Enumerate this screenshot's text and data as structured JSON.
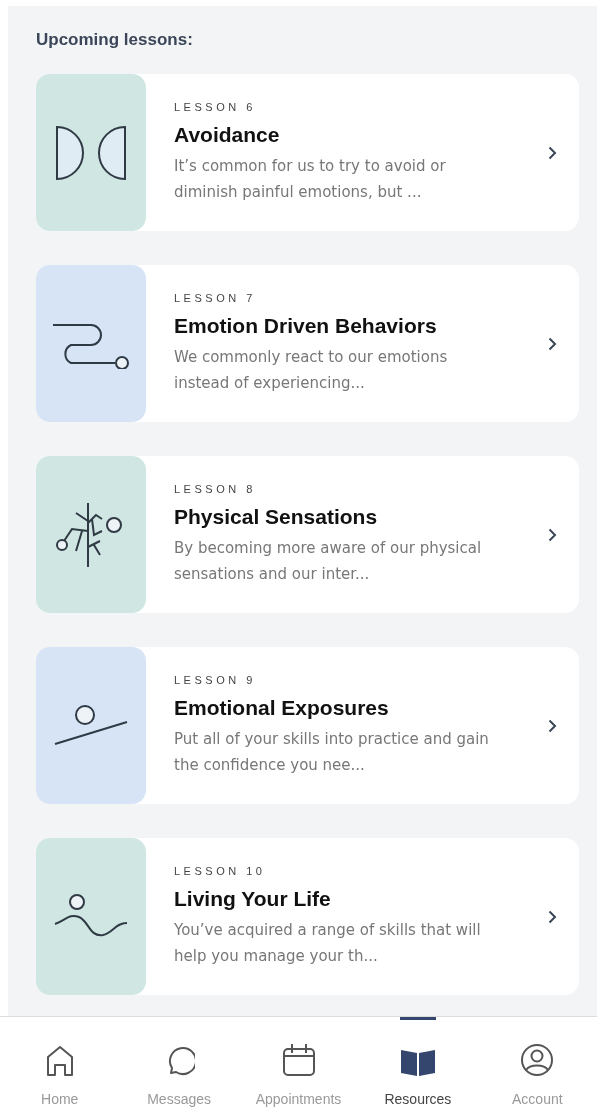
{
  "heading": "Upcoming lessons:",
  "lessons": [
    {
      "kind": "halves",
      "color": "#cfe6e2",
      "number": "LESSON 6",
      "title": "Avoidance",
      "description": "It’s common for us to try to avoid or diminish painful emotions, but ..."
    },
    {
      "kind": "path",
      "color": "#d6e4f6",
      "number": "LESSON 7",
      "title": "Emotion Driven Behaviors",
      "description": "We commonly react to our emotions instead of experiencing..."
    },
    {
      "kind": "branches",
      "color": "#cfe6e2",
      "number": "LESSON 8",
      "title": "Physical Sensations",
      "description": "By becoming more aware of our physical sensations and our inter..."
    },
    {
      "kind": "slope",
      "color": "#d6e4f6",
      "number": "LESSON 9",
      "title": "Emotional Exposures",
      "description": "Put all of your skills into practice and gain the confidence you nee..."
    },
    {
      "kind": "wave",
      "color": "#cfe6e2",
      "number": "LESSON 10",
      "title": "Living Your Life",
      "description": "You’ve acquired a range of skills that will help you manage your th..."
    }
  ],
  "nav": [
    {
      "kind": "home",
      "label": "Home",
      "selected": false
    },
    {
      "kind": "messages",
      "label": "Messages",
      "selected": false
    },
    {
      "kind": "appointments",
      "label": "Appointments",
      "selected": false
    },
    {
      "kind": "resources",
      "label": "Resources",
      "selected": true
    },
    {
      "kind": "account",
      "label": "Account",
      "selected": false
    }
  ]
}
